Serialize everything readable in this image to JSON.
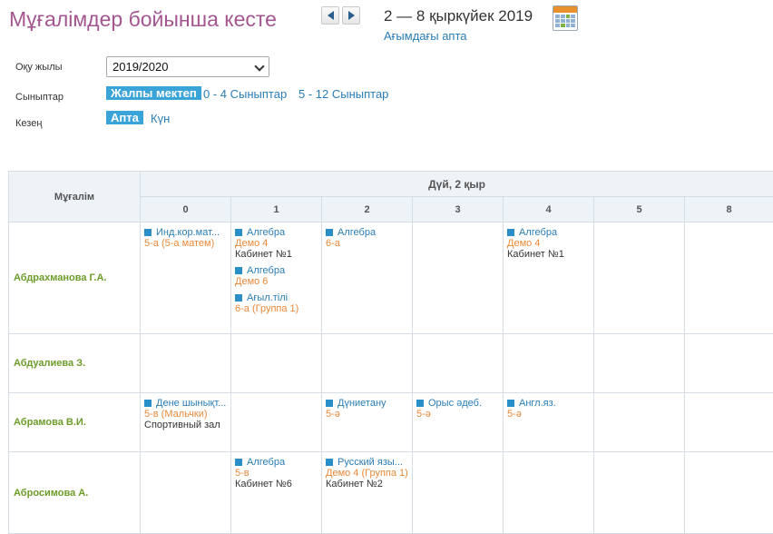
{
  "title": "Мұғалімдер бойынша кесте",
  "week_nav": {
    "range": "2 — 8 қыркүйек 2019",
    "current_week": "Ағымдағы апта",
    "prev_icon": "arrow-left-icon",
    "next_icon": "arrow-right-icon",
    "calendar_icon": "calendar-icon"
  },
  "filters": {
    "year_label": "Оқу жылы",
    "year_value": "2019/2020",
    "classes_label": "Сыныптар",
    "classes_options": [
      "Жалпы мектеп",
      "0 - 4 Сыныптар",
      "5 - 12 Сыныптар"
    ],
    "period_label": "Кезең",
    "period_options": [
      "Апта",
      "Күн"
    ]
  },
  "table": {
    "teacher_header": "Мұғалім",
    "day_header": "Дүй, 2 қыр",
    "periods": [
      "0",
      "1",
      "2",
      "3",
      "4",
      "5",
      "8"
    ],
    "rows": [
      {
        "teacher": "Абдрахманова Г.А.",
        "cells": [
          [
            {
              "subject": "Инд.кор.мат...",
              "cls": "5-а (5-а матем)",
              "room": ""
            }
          ],
          [
            {
              "subject": "Алгебра",
              "cls": "Демо 4",
              "room": "Кабинет №1"
            },
            {
              "subject": "Алгебра",
              "cls": "Демо 6",
              "room": ""
            },
            {
              "subject": "Ағыл.тілі",
              "cls": "6-а (Группа 1)",
              "room": ""
            }
          ],
          [
            {
              "subject": "Алгебра",
              "cls": "6-а",
              "room": ""
            }
          ],
          [],
          [
            {
              "subject": "Алгебра",
              "cls": "Демо 4",
              "room": "Кабинет №1"
            }
          ],
          [],
          []
        ]
      },
      {
        "teacher": "Абдуалиева З.",
        "cells": [
          [],
          [],
          [],
          [],
          [],
          [],
          []
        ]
      },
      {
        "teacher": "Абрамова В.И.",
        "cells": [
          [
            {
              "subject": "Дене шынықт...",
              "cls": "5-в (Мальчки)",
              "room": "Спортивный зал"
            }
          ],
          [],
          [
            {
              "subject": "Дүниетану",
              "cls": "5-ә",
              "room": ""
            }
          ],
          [
            {
              "subject": "Орыс әдеб.",
              "cls": "5-ә",
              "room": ""
            }
          ],
          [
            {
              "subject": "Англ.яз.",
              "cls": "5-ә",
              "room": ""
            }
          ],
          [],
          []
        ]
      },
      {
        "teacher": "Абросимова А.",
        "cells": [
          [],
          [
            {
              "subject": "Алгебра",
              "cls": "5-в",
              "room": "Кабинет №6"
            }
          ],
          [
            {
              "subject": "Русский язы...",
              "cls": "Демо 4 (Группа 1)",
              "room": "Кабинет №2"
            }
          ],
          [],
          [],
          [],
          []
        ]
      }
    ]
  }
}
